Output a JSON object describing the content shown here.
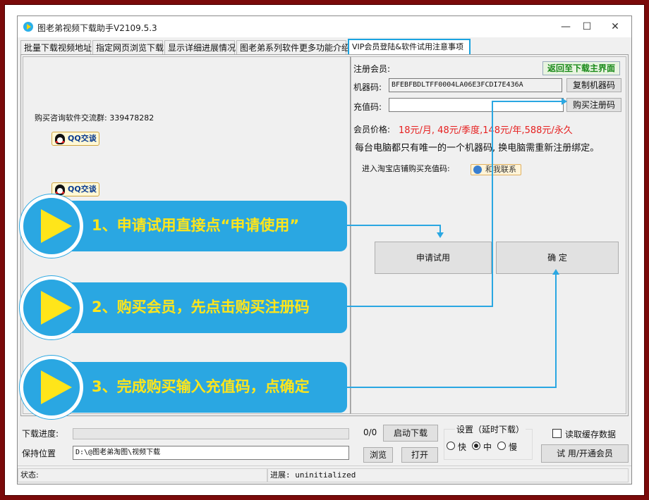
{
  "window": {
    "title": "图老弟视频下载助手V2109.5.3",
    "minimize": "—",
    "maximize": "☐",
    "close": "✕"
  },
  "tabs": [
    {
      "label": "批量下载视频地址",
      "active": false
    },
    {
      "label": "指定网页浏览下载",
      "active": false
    },
    {
      "label": "显示详细进展情况",
      "active": false
    },
    {
      "label": "图老弟系列软件更多功能介绍",
      "active": false
    },
    {
      "label": "VIP会员登陆&软件试用注意事项",
      "active": true
    }
  ],
  "left": {
    "contact_label": "购买咨询软件交流群: 339478282",
    "qq_button_1": "QQ交谈",
    "qq_button_2": "QQ交谈"
  },
  "right": {
    "reg_label": "注册会员:",
    "back_button": "返回至下载主界面",
    "machine_label": "机器码:",
    "machine_code": "BFEBFBDLTFF0004LA06E3FCDI7E436A",
    "copy_button": "复制机器码",
    "recharge_label": "充值码:",
    "recharge_value": "",
    "buy_button": "购买注册码",
    "price_label": "会员价格:",
    "price_text": "18元/月, 48元/季度,148元/年,588元/永久",
    "note": "每台电脑都只有唯一的一个机器码, 换电脑需重新注册绑定。",
    "taobao_label": "进入淘宝店铺购买充值码:",
    "contact_button": "和我联系",
    "trial_button": "申请试用",
    "confirm_button": "确    定"
  },
  "callouts": [
    "1、申请试用直接点“申请使用”",
    "2、购买会员，先点击购买注册码",
    "3、完成购买输入充值码，点确定"
  ],
  "bottom": {
    "progress_label": "下载进度:",
    "progress_count": "0/0",
    "progress_value": 0,
    "start_button": "启动下载",
    "settings_label": "设置（延时下载）",
    "radio_fast": "快",
    "radio_mid": "中",
    "radio_slow": "慢",
    "radio_selected": "中",
    "cache_label": "读取缓存数据",
    "cache_checked": false,
    "save_label": "保持位置",
    "save_path": "D:\\@图老弟淘图\\视频下载",
    "browse_button": "浏览",
    "open_button": "打开",
    "trial_member_button": "试 用/开通会员"
  },
  "status": {
    "status_label": "状态:",
    "progress_text": "进展: uninitialized"
  },
  "colors": {
    "frame": "#7a0a0a",
    "accent_blue": "#2aa7e2",
    "callout_text": "#ffe51a",
    "price_red": "#e62020",
    "back_green": "#1a8a1a"
  }
}
